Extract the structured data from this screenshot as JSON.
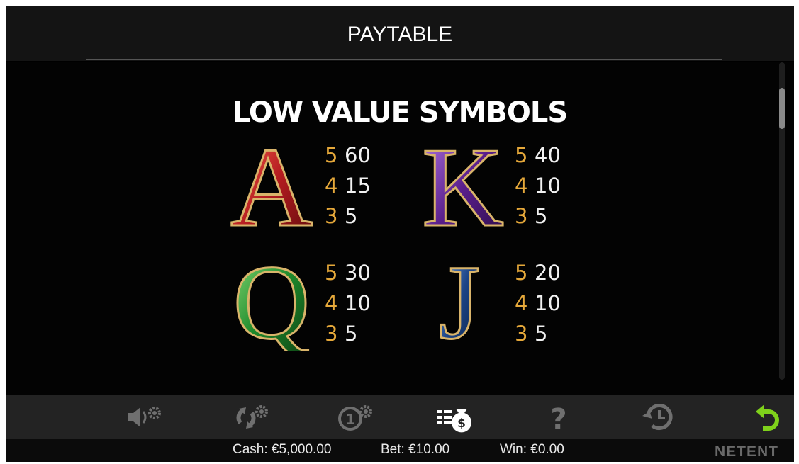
{
  "header": {
    "title": "PAYTABLE"
  },
  "section": {
    "title": "LOW VALUE SYMBOLS"
  },
  "symbols": [
    {
      "letter": "A",
      "color": "#c1222a",
      "pays": [
        {
          "count": "5",
          "value": "60"
        },
        {
          "count": "4",
          "value": "15"
        },
        {
          "count": "3",
          "value": "5"
        }
      ]
    },
    {
      "letter": "K",
      "color": "#6a2fa0",
      "pays": [
        {
          "count": "5",
          "value": "40"
        },
        {
          "count": "4",
          "value": "10"
        },
        {
          "count": "3",
          "value": "5"
        }
      ]
    },
    {
      "letter": "Q",
      "color": "#2f9a3a",
      "pays": [
        {
          "count": "5",
          "value": "30"
        },
        {
          "count": "4",
          "value": "10"
        },
        {
          "count": "3",
          "value": "5"
        }
      ]
    },
    {
      "letter": "J",
      "color": "#1f4f94",
      "pays": [
        {
          "count": "5",
          "value": "20"
        },
        {
          "count": "4",
          "value": "10"
        },
        {
          "count": "3",
          "value": "5"
        }
      ]
    }
  ],
  "toolbar": {
    "icons": [
      "sound-settings-icon",
      "autoplay-settings-icon",
      "bet-settings-icon",
      "paytable-icon",
      "help-icon",
      "history-icon",
      "back-icon"
    ],
    "active": "paytable-icon",
    "accent": "#7fd11b"
  },
  "status": {
    "cash_label": "Cash:",
    "cash_value": "€5,000.00",
    "bet_label": "Bet:",
    "bet_value": "€10.00",
    "win_label": "Win:",
    "win_value": "€0.00"
  },
  "brand": {
    "logo": "NETENT"
  },
  "colors": {
    "gold": "#e5a83a",
    "background": "#000000"
  }
}
